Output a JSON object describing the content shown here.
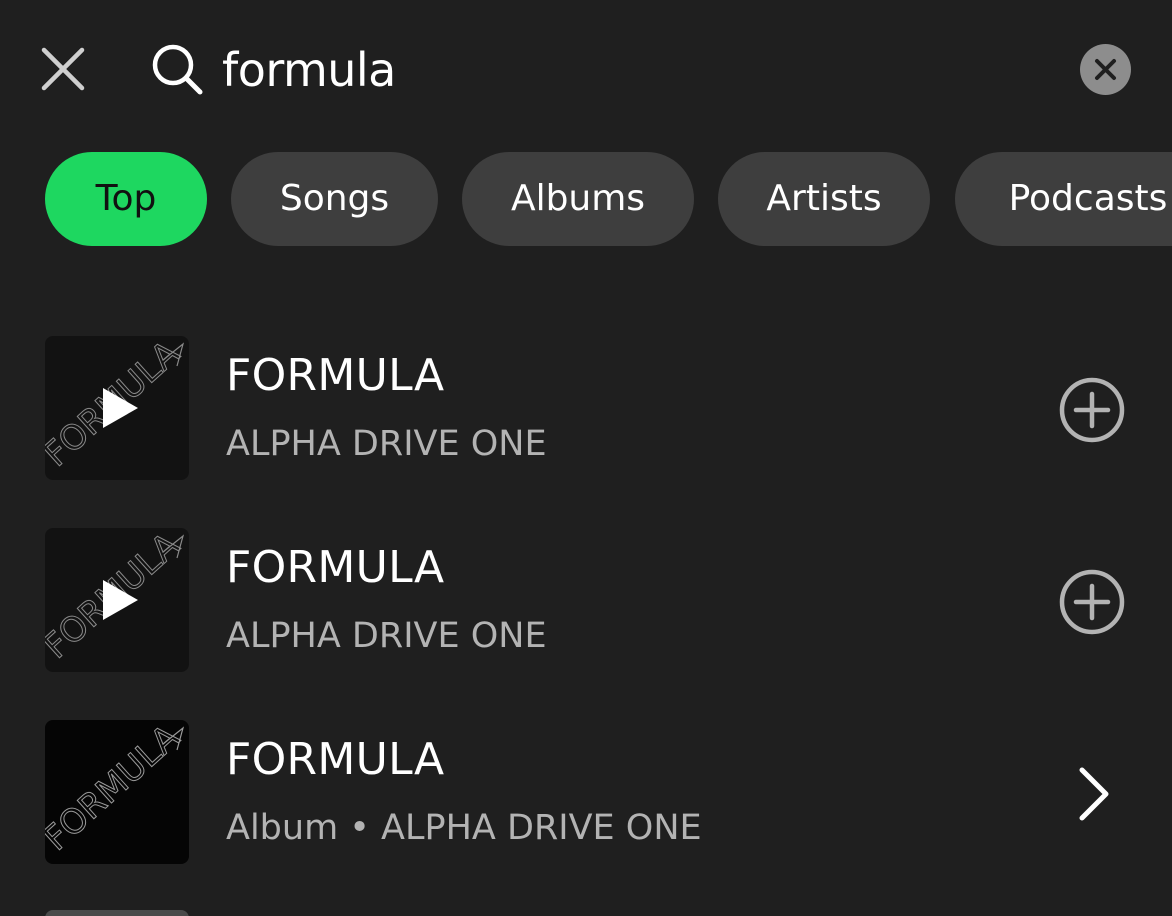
{
  "search": {
    "query": "formula"
  },
  "chips": [
    {
      "label": "Top",
      "active": true
    },
    {
      "label": "Songs",
      "active": false
    },
    {
      "label": "Albums",
      "active": false
    },
    {
      "label": "Artists",
      "active": false
    },
    {
      "label": "Podcasts",
      "active": false
    }
  ],
  "results": [
    {
      "title": "FORMULA",
      "subtitle": "ALPHA DRIVE ONE",
      "kind": "song",
      "action_icon": "add-circle-icon",
      "art_text": "FORMULA"
    },
    {
      "title": "FORMULA",
      "subtitle": "ALPHA DRIVE ONE",
      "kind": "song",
      "action_icon": "add-circle-icon",
      "art_text": "FORMULA"
    },
    {
      "title": "FORMULA",
      "subtitle": "Album • ALPHA DRIVE ONE",
      "kind": "album",
      "action_icon": "chevron-right-icon",
      "art_text": "FORMULA"
    }
  ],
  "colors": {
    "background": "#1f1f1f",
    "accent": "#1ed760",
    "chip": "#3e3e3e",
    "subtext": "#b3b3b3"
  }
}
